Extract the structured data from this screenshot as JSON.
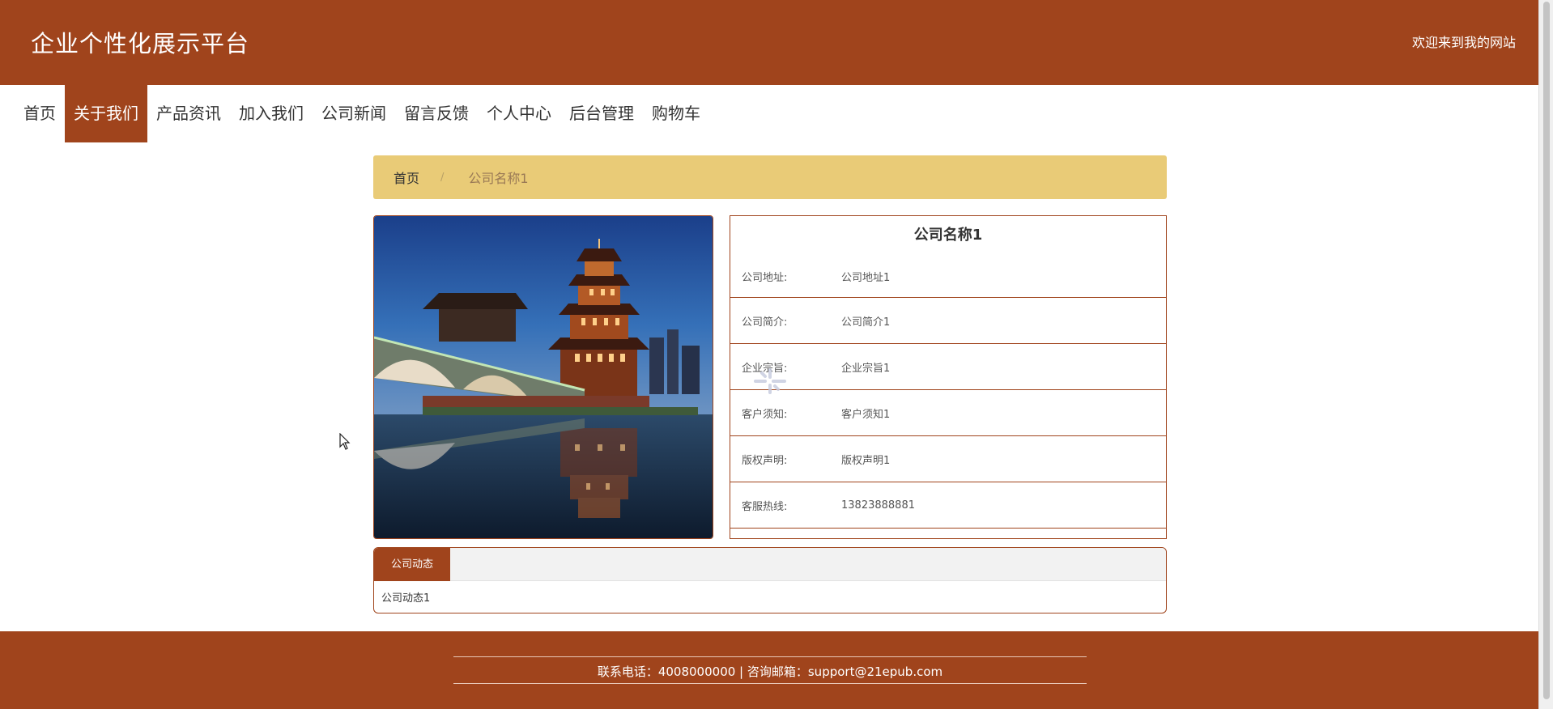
{
  "header": {
    "title": "企业个性化展示平台",
    "welcome": "欢迎来到我的网站"
  },
  "nav": {
    "items": [
      {
        "label": "首页"
      },
      {
        "label": "关于我们",
        "active": true
      },
      {
        "label": "产品资讯"
      },
      {
        "label": "加入我们"
      },
      {
        "label": "公司新闻"
      },
      {
        "label": "留言反馈"
      },
      {
        "label": "个人中心"
      },
      {
        "label": "后台管理"
      },
      {
        "label": "购物车"
      }
    ]
  },
  "breadcrumb": {
    "home": "首页",
    "separator": "/",
    "current": "公司名称1"
  },
  "company": {
    "name": "公司名称1",
    "rows": [
      {
        "label": "公司地址:",
        "value": "公司地址1"
      },
      {
        "label": "公司简介:",
        "value": "公司简介1"
      },
      {
        "label": "企业宗旨:",
        "value": "企业宗旨1"
      },
      {
        "label": "客户须知:",
        "value": "客户须知1"
      },
      {
        "label": "版权声明:",
        "value": "版权声明1"
      },
      {
        "label": "客服热线:",
        "value": "13823888881"
      }
    ]
  },
  "news": {
    "tab_label": "公司动态",
    "content": "公司动态1"
  },
  "footer": {
    "text": "联系电话：4008000000 | 咨询邮箱：support@21epub.com"
  },
  "colors": {
    "primary": "#a0441c",
    "breadcrumb_bg": "#e9cb77",
    "tab_bar_bg": "#f2f2f2"
  }
}
